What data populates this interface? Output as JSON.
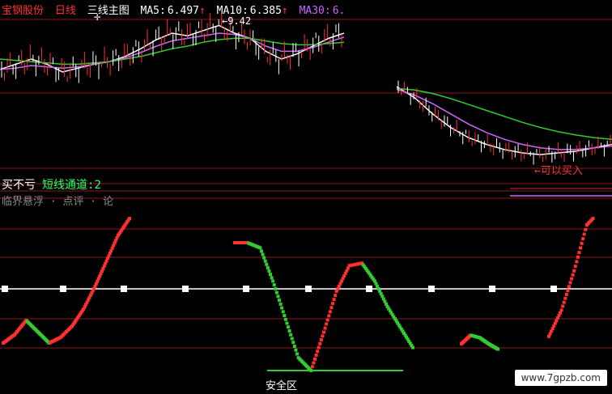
{
  "header": {
    "stock_name": "宝钢股份",
    "period": "日线",
    "panel_title": "三线主图",
    "ma5_label": "MA5:",
    "ma5_value": "6.497",
    "ma10_label": "MA10:",
    "ma10_value": "6.385",
    "ma30_label": "MA30:",
    "ma30_value": "6.",
    "up_arrow": "↑"
  },
  "annotations": {
    "peak_price": "9.42",
    "buy_signal": "可以买入"
  },
  "indicator": {
    "label_1": "买不亏",
    "label_2": "短线通道:",
    "label_2_value": "2",
    "label_3": "临界悬浮 · 点评 · 论",
    "zone_label": "安全区"
  },
  "watermark": "www.7gpzb.com",
  "colors": {
    "background": "#000000",
    "up": "#ff3030",
    "down": "#33cc33",
    "ma5": "#ffffff",
    "ma10": "#cc66ff",
    "ma30": "#33cc33",
    "grid": "#8b1a1a",
    "header_red": "#ff3333",
    "header_purple": "#cc66ff",
    "short_channel": "#33ff66"
  },
  "chart_data": {
    "type": "line",
    "series": [
      {
        "name": "MA5",
        "values": [
          0.62,
          0.66,
          0.7,
          0.66,
          0.6,
          0.63,
          0.66,
          0.68,
          0.72,
          0.78,
          0.85,
          0.9,
          0.88,
          0.92,
          0.96,
          0.9,
          0.86,
          0.76,
          0.7,
          0.74,
          0.8,
          0.86,
          0.9
        ]
      },
      {
        "name": "MA10",
        "values": [
          0.62,
          0.63,
          0.65,
          0.64,
          0.63,
          0.64,
          0.66,
          0.68,
          0.71,
          0.75,
          0.8,
          0.84,
          0.86,
          0.88,
          0.9,
          0.89,
          0.86,
          0.8,
          0.76,
          0.76,
          0.79,
          0.83,
          0.87
        ]
      },
      {
        "name": "MA30",
        "values": [
          0.7,
          0.69,
          0.68,
          0.67,
          0.66,
          0.66,
          0.67,
          0.68,
          0.7,
          0.72,
          0.75,
          0.78,
          0.8,
          0.83,
          0.85,
          0.86,
          0.86,
          0.84,
          0.82,
          0.81,
          0.81,
          0.82,
          0.83
        ]
      },
      {
        "name": "短线通道",
        "values": [
          0.12,
          0.18,
          0.28,
          0.2,
          0.12,
          0.16,
          0.24,
          0.36,
          0.52,
          0.7,
          0.88,
          1.0,
          1.0,
          0.96,
          0.7,
          0.4,
          0.1,
          0.0,
          0.3,
          0.62,
          0.82,
          0.84,
          0.7,
          0.5,
          0.34,
          0.18
        ]
      }
    ]
  }
}
